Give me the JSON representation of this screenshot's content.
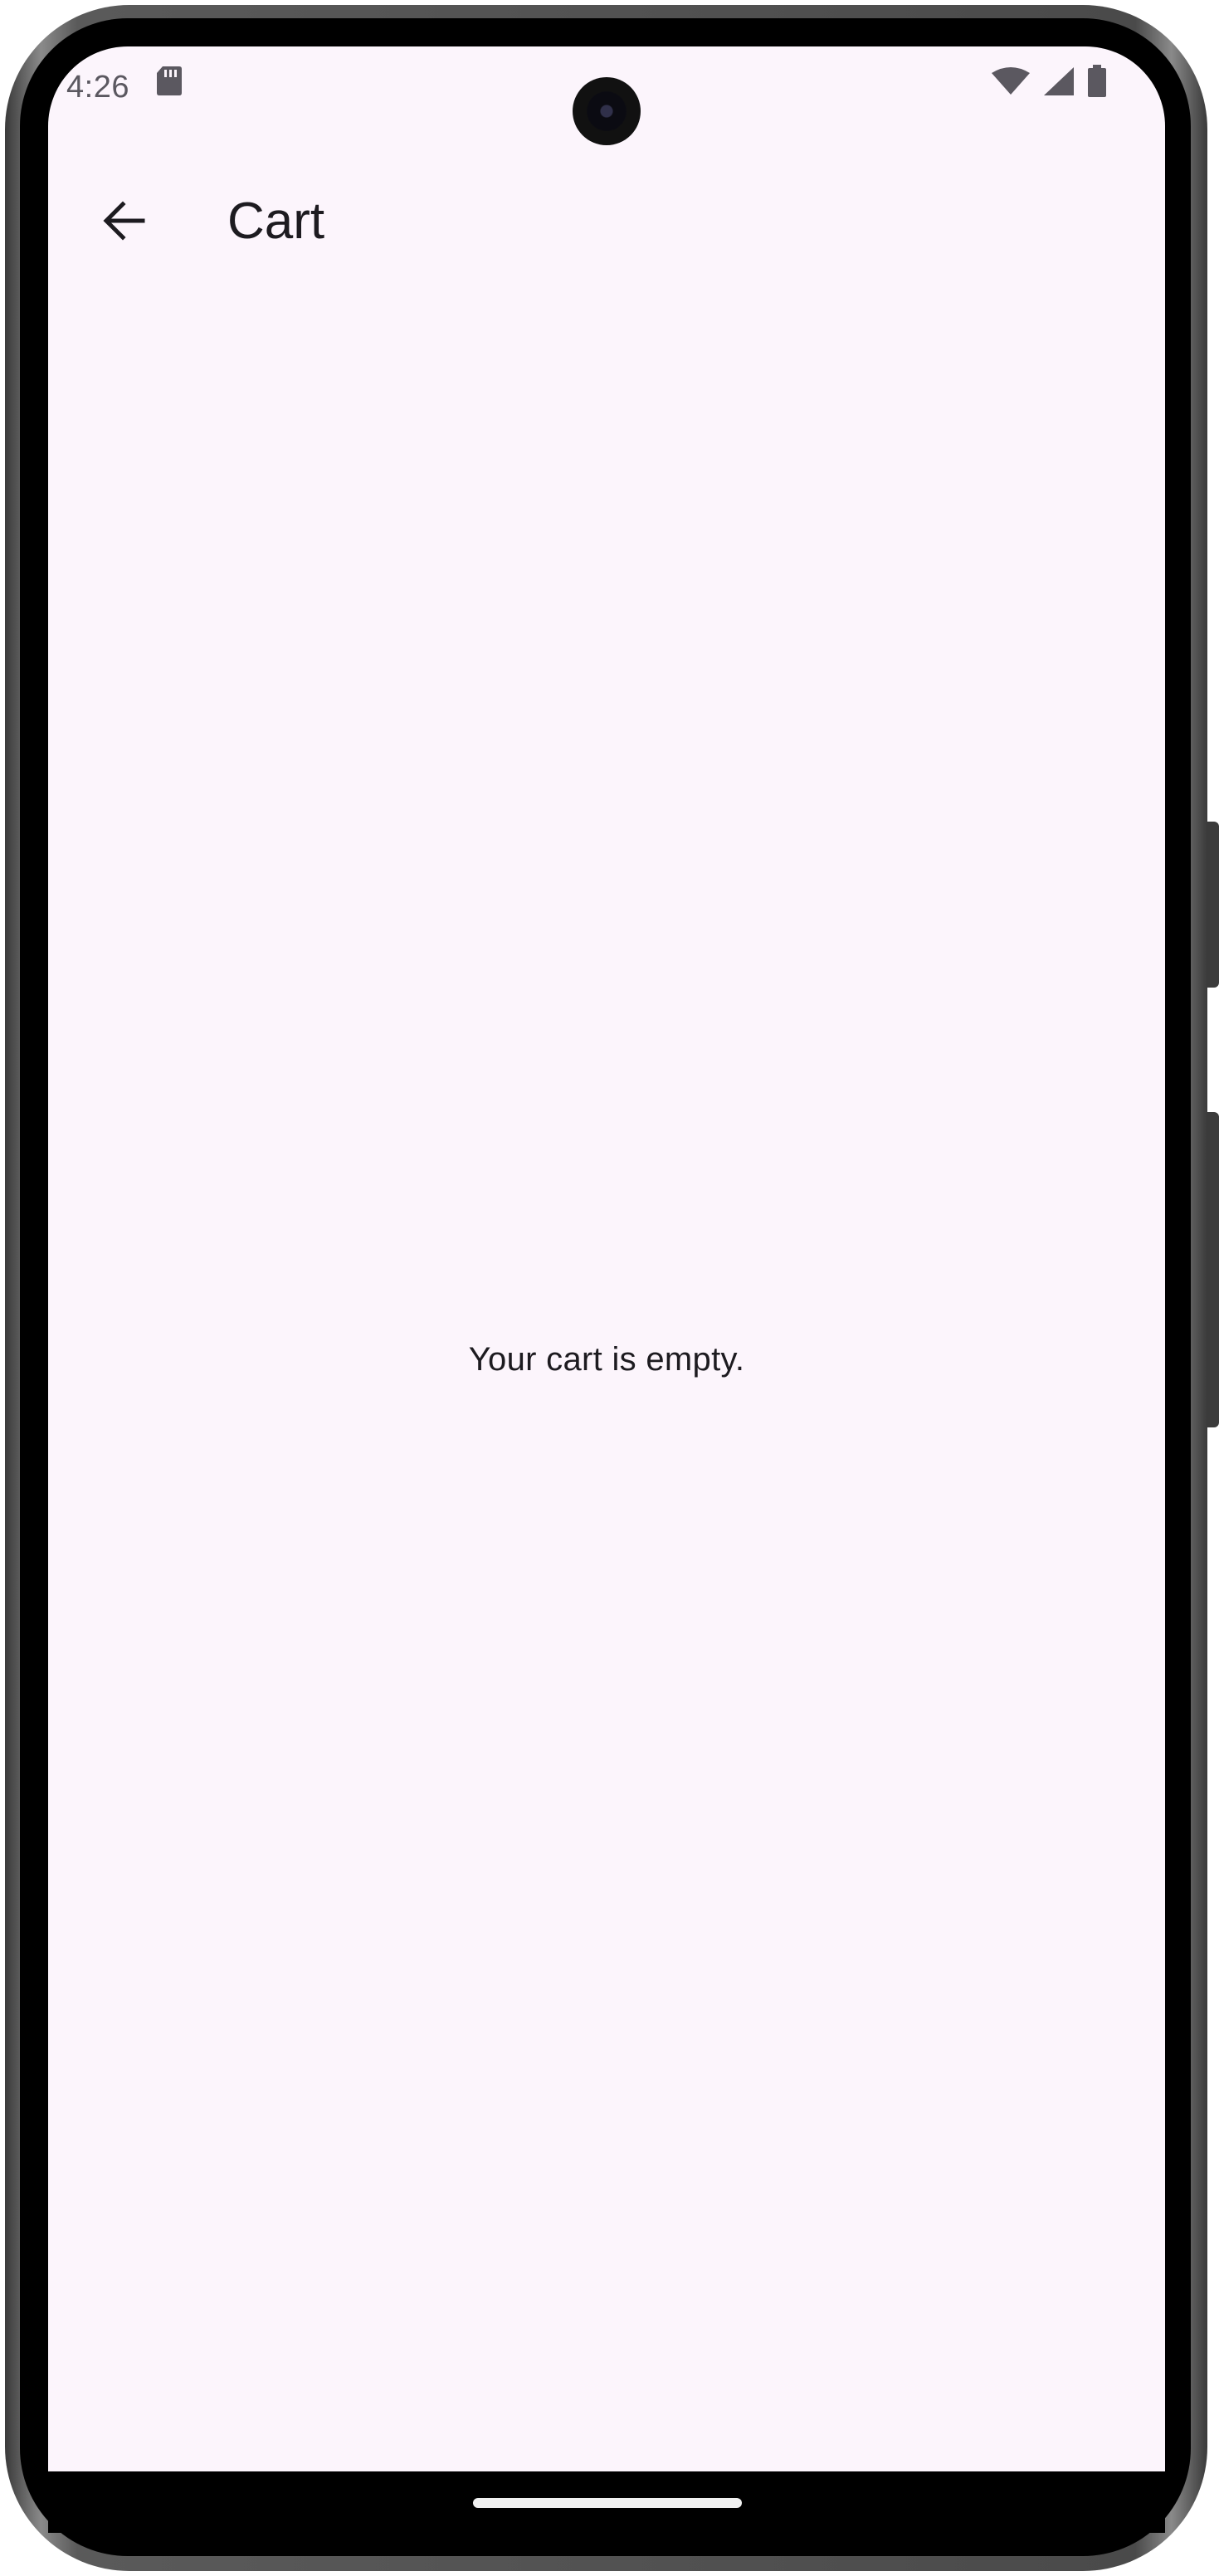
{
  "status_bar": {
    "time": "4:26",
    "icons": [
      "sd-card-icon",
      "wifi-icon",
      "cellular-signal-icon",
      "battery-icon"
    ]
  },
  "app_bar": {
    "back_icon": "arrow-back-icon",
    "title": "Cart"
  },
  "content": {
    "empty_message": "Your cart is empty."
  },
  "colors": {
    "background": "#fcf5fc",
    "text": "#1d1b20",
    "status_text": "#5b5860"
  }
}
